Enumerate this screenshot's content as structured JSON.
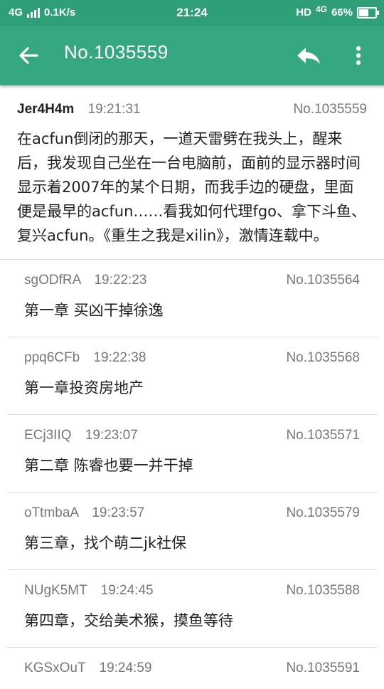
{
  "statusbar": {
    "network": "4G",
    "speed": "0.1K/s",
    "time": "21:24",
    "hd": "HD",
    "network_right": "4G",
    "battery": "66%",
    "battery_level": 0.66
  },
  "appbar": {
    "title": "No.1035559",
    "icons": [
      "arrow-back-icon",
      "reply-icon",
      "more-vert-icon"
    ]
  },
  "posts": [
    {
      "user": "Jer4H4m",
      "time": "19:21:31",
      "no": "No.1035559",
      "content": "在acfun倒闭的那天，一道天雷劈在我头上，醒来后，我发现自己坐在一台电脑前，面前的显示器时间显示着2007年的某个日期，而我手边的硬盘，里面便是最早的acfun……看我如何代理fgo、拿下斗鱼、复兴acfun。《重生之我是xilin》，激情连载中。"
    },
    {
      "user": "sgODfRA",
      "time": "19:22:23",
      "no": "No.1035564",
      "content": "第一章 买凶干掉徐逸"
    },
    {
      "user": "ppq6CFb",
      "time": "19:22:38",
      "no": "No.1035568",
      "content": "第一章投资房地产"
    },
    {
      "user": "ECj3IIQ",
      "time": "19:23:07",
      "no": "No.1035571",
      "content": "第二章 陈睿也要一并干掉"
    },
    {
      "user": "oTtmbaA",
      "time": "19:23:57",
      "no": "No.1035579",
      "content": "第三章，找个萌二jk社保"
    },
    {
      "user": "NUgK5MT",
      "time": "19:24:45",
      "no": "No.1035588",
      "content": "第四章，交给美术猴，摸鱼等待"
    },
    {
      "user": "KGSxOuT",
      "time": "19:24:59",
      "no": "No.1035591",
      "content": ""
    }
  ],
  "colors": {
    "statusbar": "#2f9f78",
    "appbar": "#35a882",
    "text": "#222222",
    "meta": "#777777"
  }
}
